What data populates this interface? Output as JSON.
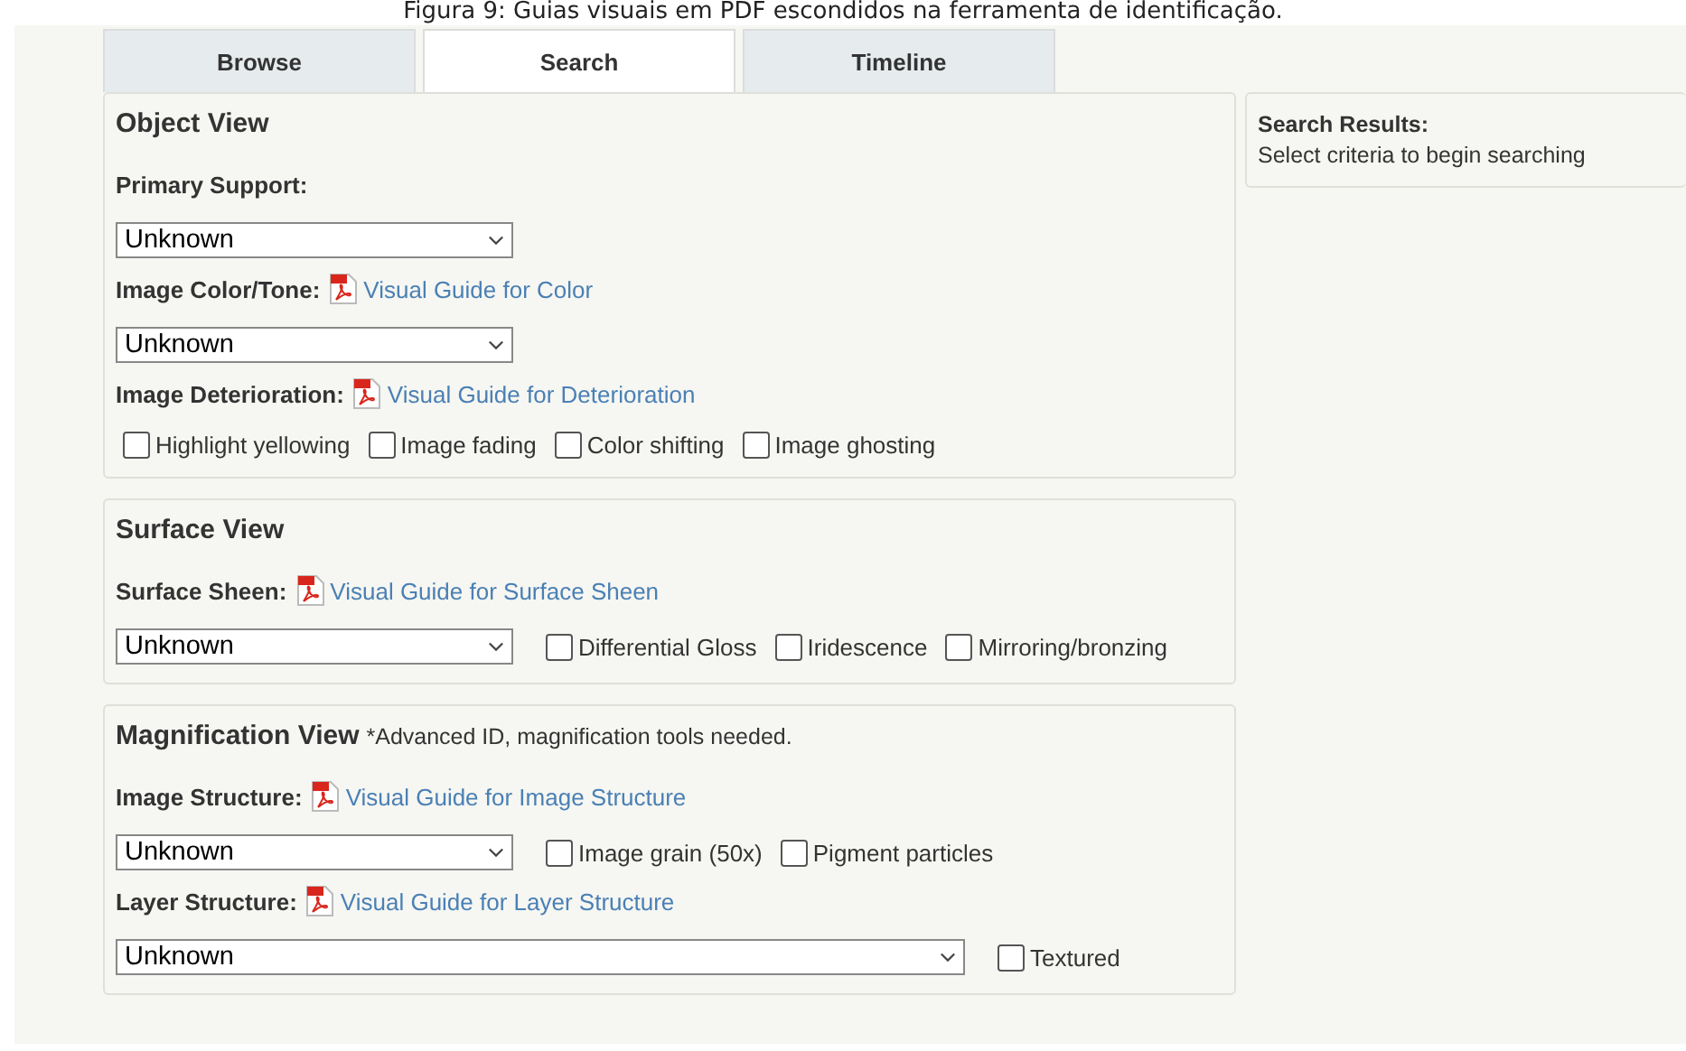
{
  "caption": "Figura 9: Guias visuais em PDF escondidos na ferramenta de identificação.",
  "tabs": [
    {
      "label": "Browse",
      "selected": false
    },
    {
      "label": "Search",
      "selected": true
    },
    {
      "label": "Timeline",
      "selected": false
    }
  ],
  "sections": [
    {
      "title": "Object View",
      "fields": [
        {
          "label": "Primary Support:",
          "select": {
            "value": "Unknown",
            "wide": false
          }
        },
        {
          "label": "Image Color/Tone:",
          "guide": "Visual Guide for Color",
          "select": {
            "value": "Unknown",
            "wide": false
          }
        },
        {
          "label": "Image Deterioration:",
          "guide": "Visual Guide for Deterioration",
          "options": [
            {
              "label": "Highlight yellowing",
              "checked": false
            },
            {
              "label": "Image fading",
              "checked": false
            },
            {
              "label": "Color shifting",
              "checked": false
            },
            {
              "label": "Image ghosting",
              "checked": false
            }
          ]
        }
      ]
    },
    {
      "title": "Surface View",
      "fields": [
        {
          "label": "Surface Sheen:",
          "guide": "Visual Guide for Surface Sheen",
          "select": {
            "value": "Unknown",
            "wide": false
          },
          "options": [
            {
              "label": "Differential Gloss",
              "checked": false
            },
            {
              "label": "Iridescence",
              "checked": false
            },
            {
              "label": "Mirroring/bronzing",
              "checked": false
            }
          ]
        }
      ]
    },
    {
      "title": "Magnification View",
      "note": "*Advanced ID, magnification tools needed.",
      "fields": [
        {
          "label": "Image Structure:",
          "guide": "Visual Guide for Image Structure",
          "select": {
            "value": "Unknown",
            "wide": false
          },
          "options": [
            {
              "label": "Image grain (50x)",
              "checked": false
            },
            {
              "label": "Pigment particles",
              "checked": false
            }
          ]
        },
        {
          "label": "Layer Structure:",
          "guide": "Visual Guide for Layer Structure",
          "select": {
            "value": "Unknown",
            "wide": true
          },
          "options": [
            {
              "label": "Textured",
              "checked": false
            }
          ]
        }
      ]
    }
  ],
  "results": {
    "title": "Search Results:",
    "message": "Select criteria to begin searching"
  }
}
